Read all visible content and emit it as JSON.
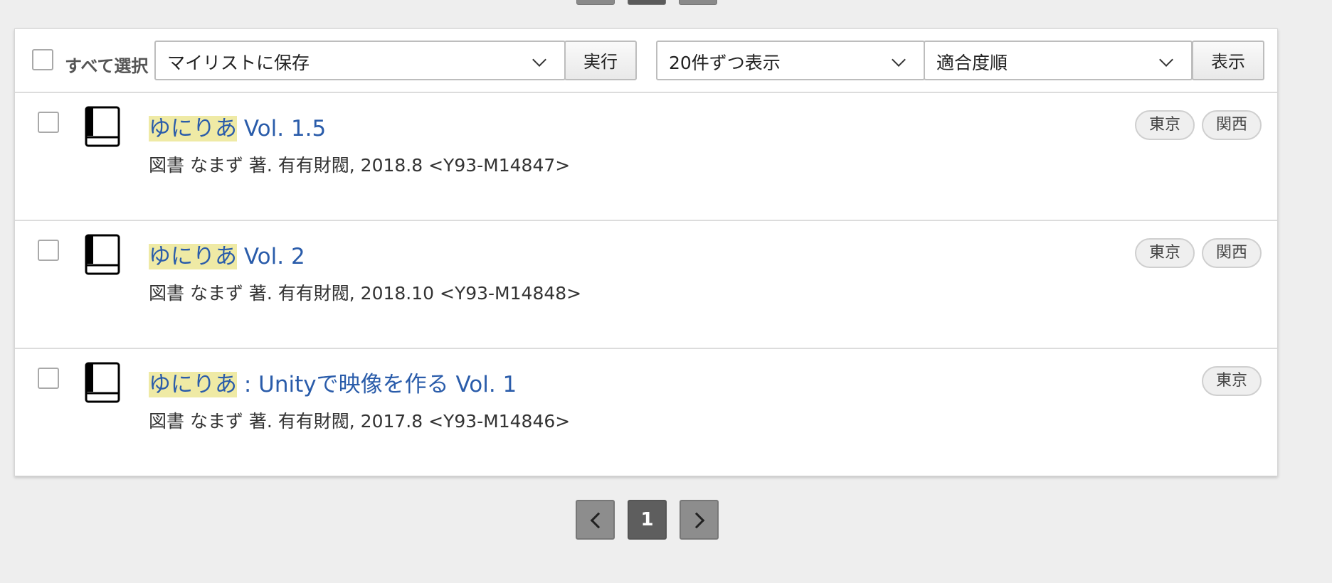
{
  "toolbar": {
    "select_all_label": "すべて選択",
    "action_select_value": "マイリストに保存",
    "execute_label": "実行",
    "per_page_value": "20件ずつ表示",
    "sort_value": "適合度順",
    "display_label": "表示"
  },
  "results": [
    {
      "title_highlight": "ゆにりあ",
      "title_rest": " Vol. 1.5",
      "meta": "図書 なまず 著. 有有財閥, 2018.8 <Y93-M14847>",
      "badges": [
        "東京",
        "関西"
      ]
    },
    {
      "title_highlight": "ゆにりあ",
      "title_rest": " Vol. 2",
      "meta": "図書 なまず 著. 有有財閥, 2018.10 <Y93-M14848>",
      "badges": [
        "東京",
        "関西"
      ]
    },
    {
      "title_highlight": "ゆにりあ",
      "title_rest": " : Unityで映像を作る Vol. 1",
      "meta": "図書 なまず 著. 有有財閥, 2017.8 <Y93-M14846>",
      "badges": [
        "東京"
      ]
    }
  ],
  "pagination": {
    "current_page": "1"
  },
  "colors": {
    "link": "#2a5caa",
    "highlight": "#efeaa5",
    "page_bg": "#eeeeee"
  }
}
